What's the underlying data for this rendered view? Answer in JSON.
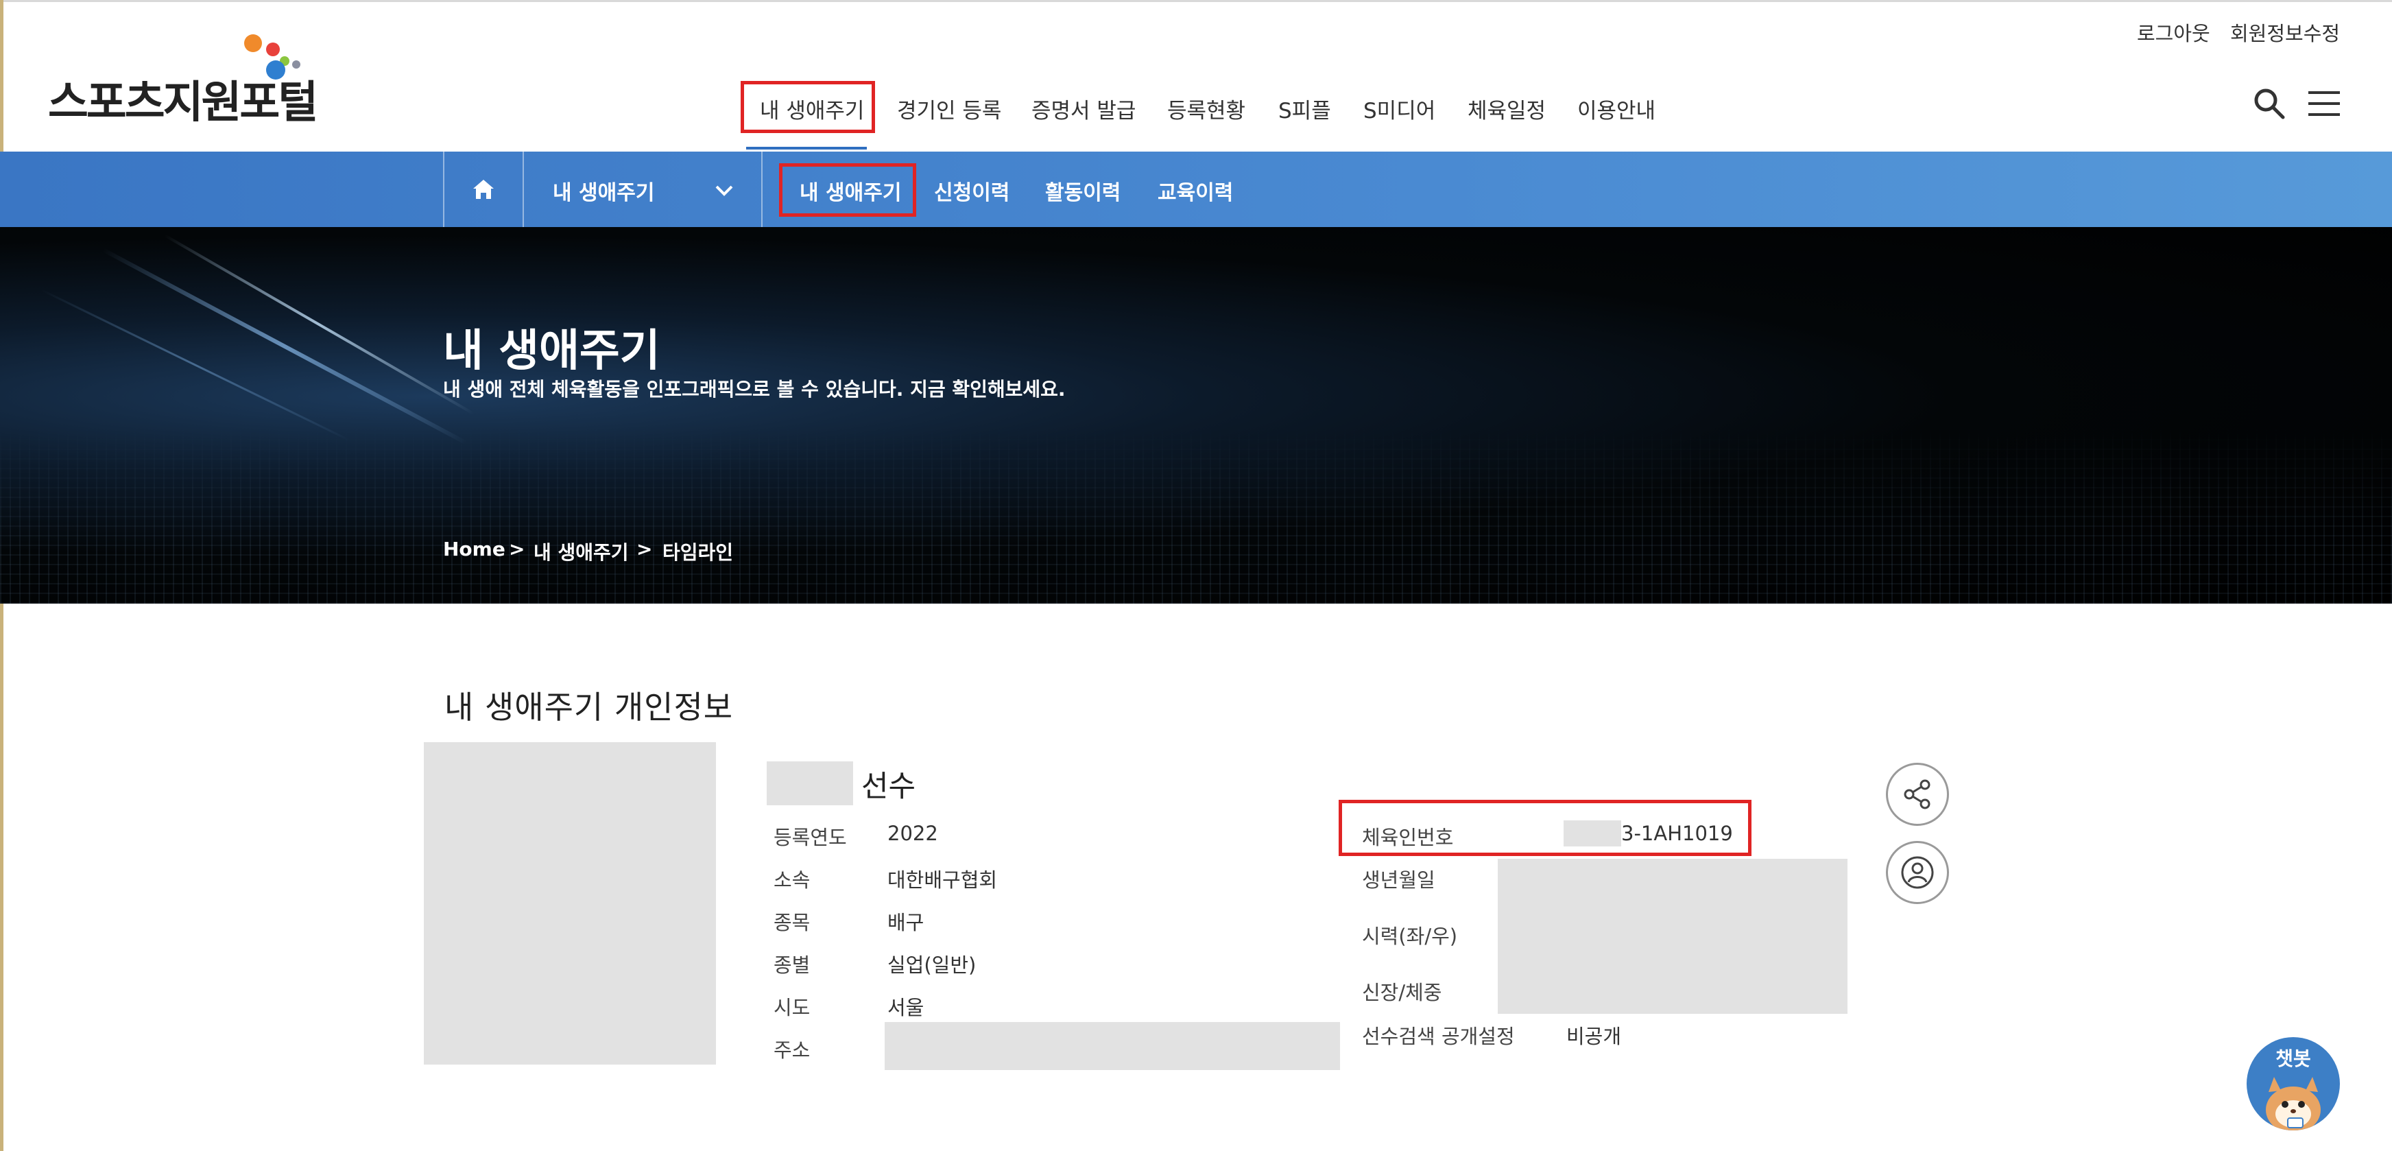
{
  "header": {
    "logo_text": "스포츠지원포털",
    "util_links": [
      "로그아웃",
      "회원정보수정"
    ],
    "gnb": [
      "내 생애주기",
      "경기인 등록",
      "증명서 발급",
      "등록현황",
      "S피플",
      "S미디어",
      "체육일정",
      "이용안내"
    ]
  },
  "subnav": {
    "dropdown_label": "내 생애주기",
    "tabs": [
      "내 생애주기",
      "신청이력",
      "활동이력",
      "교육이력"
    ]
  },
  "hero": {
    "title": "내 생애주기",
    "subtitle": "내 생애 전체 체육활동을 인포그래픽으로 볼 수 있습니다. 지금 확인해보세요.",
    "breadcrumb": [
      "Home",
      ">",
      "내 생애주기",
      ">",
      "타임라인"
    ]
  },
  "profile": {
    "section_title": "내 생애주기 개인정보",
    "name_suffix": "선수",
    "left_fields": [
      {
        "label": "등록연도",
        "value": "2022"
      },
      {
        "label": "소속",
        "value": "대한배구협회"
      },
      {
        "label": "종목",
        "value": "배구"
      },
      {
        "label": "종별",
        "value": "실업(일반)"
      },
      {
        "label": "시도",
        "value": "서울"
      },
      {
        "label": "주소",
        "value": ""
      }
    ],
    "right_fields": [
      {
        "label": "체육인번호",
        "value": "3-1AH1019"
      },
      {
        "label": "생년월일",
        "value": ""
      },
      {
        "label": "시력(좌/우)",
        "value": ""
      },
      {
        "label": "신장/체중",
        "value": ""
      },
      {
        "label": "선수검색 공개설정",
        "value": "비공개"
      }
    ]
  },
  "chatbot": {
    "label": "챗봇"
  },
  "colors": {
    "accent": "#3a76c4",
    "highlight": "#e02424"
  }
}
